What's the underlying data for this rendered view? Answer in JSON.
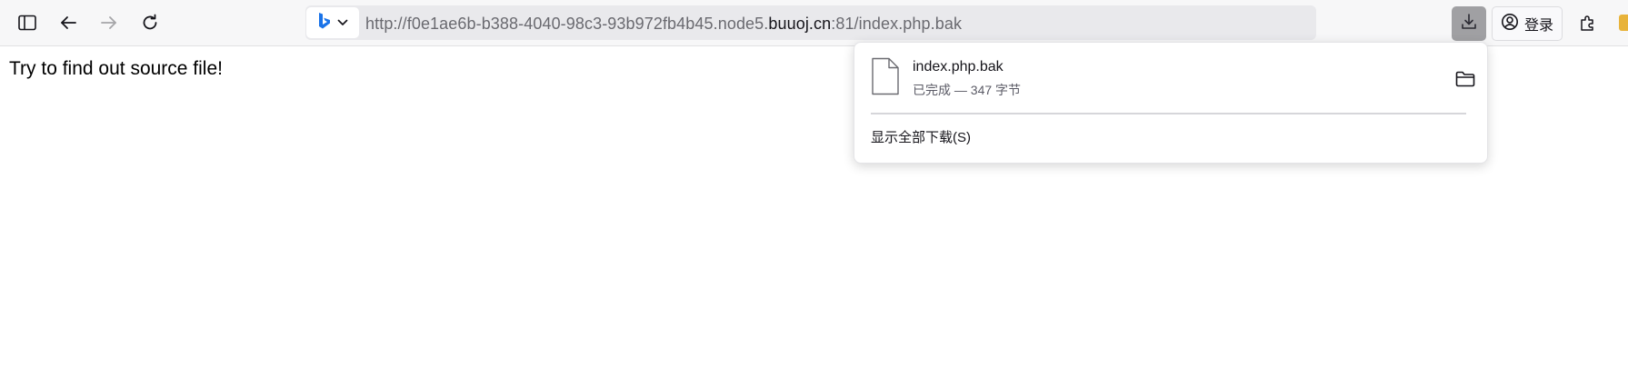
{
  "browser": {
    "toolbar": {
      "sidebar_icon": "sidebar-icon",
      "back_icon": "arrow-left-icon",
      "forward_icon": "arrow-right-icon",
      "reload_icon": "reload-icon"
    },
    "urlbar": {
      "search_engine_icon": "bing-icon",
      "url_prefix": "http://f0e1ae6b-b388-4040-98c3-93b972fb4b45.node5.",
      "url_domain": "buuoj.cn",
      "url_suffix": ":81/index.php.bak"
    },
    "signin_label": "登录",
    "colors": {
      "downloads_active": "#a0a0a3",
      "bing_blue": "#1a73e8"
    }
  },
  "page": {
    "text": "Try to find out source file!"
  },
  "downloads_panel": {
    "items": [
      {
        "filename": "index.php.bak",
        "status": "已完成 — 347 字节",
        "file_icon": "file-icon",
        "folder_icon": "folder-icon"
      }
    ],
    "show_all_label": "显示全部下载(S)"
  }
}
